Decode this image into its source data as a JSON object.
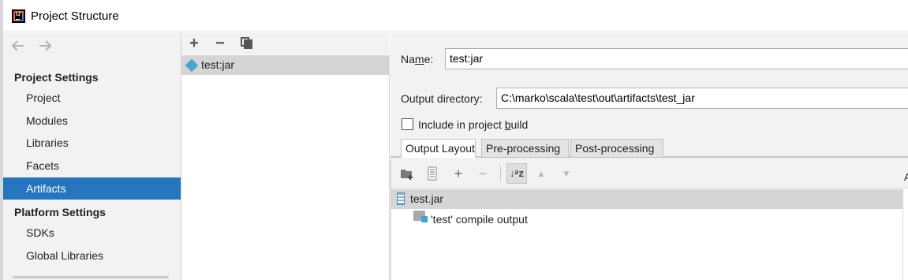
{
  "window": {
    "title": "Project Structure",
    "app_icon": "intellij-idea-icon"
  },
  "sidebar": {
    "nav_back_icon": "arrow-left-icon",
    "nav_forward_icon": "arrow-right-icon",
    "project_settings_header": "Project Settings",
    "project_settings_items": [
      {
        "label": "Project"
      },
      {
        "label": "Modules"
      },
      {
        "label": "Libraries"
      },
      {
        "label": "Facets"
      },
      {
        "label": "Artifacts",
        "selected": true
      }
    ],
    "platform_settings_header": "Platform Settings",
    "platform_settings_items": [
      {
        "label": "SDKs"
      },
      {
        "label": "Global Libraries"
      }
    ]
  },
  "artifacts_panel": {
    "toolbar": {
      "add_symbol": "+",
      "remove_symbol": "−"
    },
    "artifacts": [
      {
        "label": "test:jar",
        "selected": true
      }
    ]
  },
  "config": {
    "name_label": "Name:",
    "name_value": "test:jar",
    "output_dir_label": "Output directory:",
    "output_dir_value": "C:\\marko\\scala\\test\\out\\artifacts\\test_jar",
    "include_in_build_label": "Include in project build",
    "include_in_build_checked": false,
    "tabs": [
      {
        "label": "Output Layout",
        "active": true
      },
      {
        "label": "Pre-processing"
      },
      {
        "label": "Post-processing"
      }
    ],
    "layout_toolbar": {
      "add_symbol": "+",
      "remove_symbol": "−",
      "sort_symbol": "↓ᵃz",
      "up_symbol": "▲",
      "down_symbol": "▼",
      "right_edge_text": "A"
    },
    "tree": [
      {
        "label": "test.jar",
        "level": 0,
        "selected": true
      },
      {
        "label": "'test' compile output",
        "level": 1
      }
    ]
  },
  "colors": {
    "selection_blue": "#2675bf",
    "panel_gray": "#f2f2f2",
    "row_selected_gray": "#d5d5d5"
  }
}
